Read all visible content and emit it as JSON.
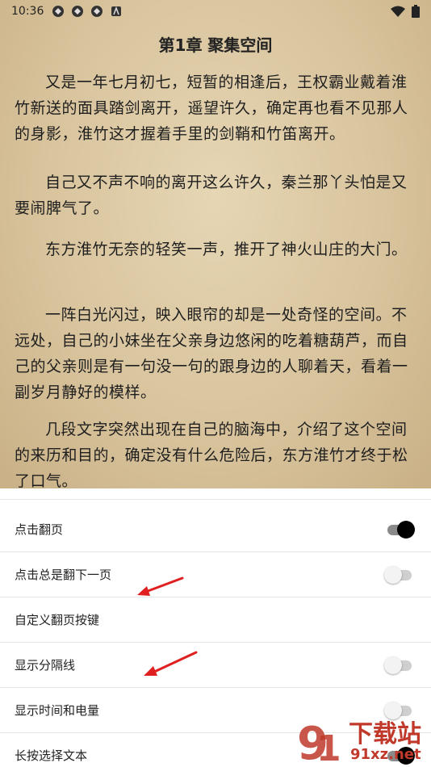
{
  "status": {
    "time": "10:36",
    "icons": [
      "app-icon",
      "app-icon",
      "app-icon",
      "notification-icon"
    ],
    "right_icons": [
      "wifi-icon",
      "battery-icon"
    ]
  },
  "reader": {
    "chapter_title": "第1章 聚集空间",
    "paragraphs": [
      "又是一年七月初七，短暂的相逢后，王权霸业戴着淮竹新送的面具踏剑离开，遥望许久，确定再也看不见那人的身影，淮竹这才握着手里的剑鞘和竹笛离开。",
      "自己又不声不响的离开这么许久，秦兰那丫头怕是又要闹脾气了。",
      "东方淮竹无奈的轻笑一声，推开了神火山庄的大门。",
      "一阵白光闪过，映入眼帘的却是一处奇怪的空间。不远处，自己的小妹坐在父亲身边悠闲的吃着糖葫芦，而自己的父亲则是有一句没一句的跟身边的人聊着天，看着一副岁月静好的模样。",
      "几段文字突然出现在自己的脑海中，介绍了这个空间的来历和目的，确定没有什么危险后，东方淮竹才终于松了口气。"
    ]
  },
  "settings": {
    "items": [
      {
        "label": "点击翻页",
        "toggle": true
      },
      {
        "label": "点击总是翻下一页",
        "toggle": false
      },
      {
        "label": "自定义翻页按键"
      },
      {
        "label": "显示分隔线",
        "toggle": false
      },
      {
        "label": "显示时间和电量",
        "toggle": false
      },
      {
        "label": "长按选择文本",
        "toggle": true
      }
    ]
  },
  "watermark": {
    "text": "下载站",
    "url": "91xz.net"
  },
  "colors": {
    "annotation_arrow": "#e02020",
    "toggle_on": "#000000",
    "watermark": "#c0392b"
  }
}
